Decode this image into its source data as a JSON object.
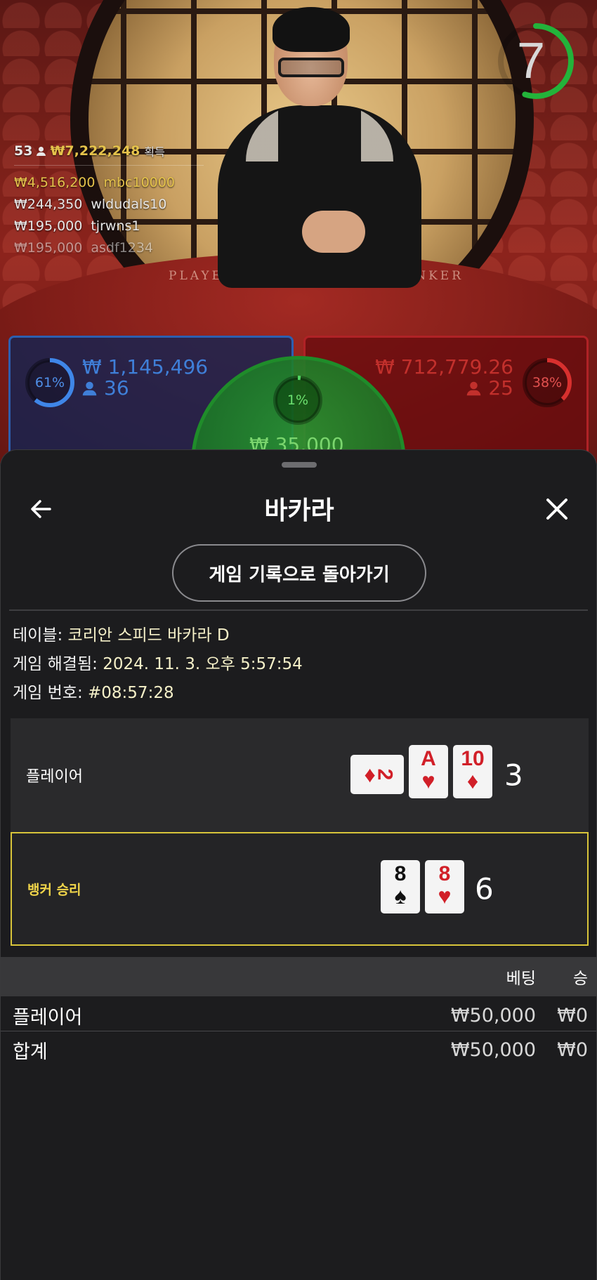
{
  "video": {
    "countdown": "7",
    "countdown_fraction": 0.55,
    "table_words": {
      "player": "PLAYER",
      "banker": "BANKER"
    }
  },
  "winners": {
    "count": "53",
    "total": "₩7,222,248",
    "total_label": "획득",
    "list": [
      {
        "amount": "₩4,516,200",
        "name": "mbc10000"
      },
      {
        "amount": "₩244,350",
        "name": "wldudals10"
      },
      {
        "amount": "₩195,000",
        "name": "tjrwns1"
      },
      {
        "amount": "₩195,000",
        "name": "asdf1234"
      }
    ]
  },
  "bet_spots": {
    "player": {
      "percent": "61%",
      "percent_value": 0.61,
      "amount": "₩ 1,145,496",
      "players": "36",
      "color": "#2c5fb0"
    },
    "banker": {
      "percent": "38%",
      "percent_value": 0.38,
      "amount": "₩ 712,779.26",
      "players": "25",
      "color": "#b02226"
    },
    "tie": {
      "percent": "1%",
      "percent_value": 0.01,
      "amount": "₩ 35,000",
      "color": "#1f8c2a"
    }
  },
  "sheet": {
    "title": "바카라",
    "back_icon": "arrow-left-icon",
    "close_icon": "close-icon",
    "history_button": "게임 기록으로 돌아가기",
    "info": {
      "table_label": "테이블:",
      "table_value": "코리안 스피드 바카라 D",
      "resolved_label": "게임 해결됨:",
      "resolved_value": "2024. 11. 3. 오후 5:57:54",
      "number_label": "게임 번호:",
      "number_value": "#08:57:28"
    },
    "player_round": {
      "label": "플레이어",
      "score": "3",
      "cards": [
        {
          "rank": "2",
          "suit": "♦",
          "color": "red",
          "sideways": true
        },
        {
          "rank": "A",
          "suit": "♥",
          "color": "red",
          "sideways": false
        },
        {
          "rank": "10",
          "suit": "♦",
          "color": "red",
          "sideways": false
        }
      ]
    },
    "banker_round": {
      "label": "뱅커 승리",
      "score": "6",
      "highlight_color": "#d8c43a",
      "cards": [
        {
          "rank": "8",
          "suit": "♠",
          "color": "black",
          "sideways": false
        },
        {
          "rank": "8",
          "suit": "♥",
          "color": "red",
          "sideways": false
        }
      ]
    },
    "bets_table": {
      "headers": {
        "bet": "베팅",
        "win": "승"
      },
      "rows": [
        {
          "name": "플레이어",
          "bet": "₩50,000",
          "win": "₩0"
        }
      ],
      "total": {
        "name": "합계",
        "bet": "₩50,000",
        "win": "₩0"
      }
    }
  }
}
